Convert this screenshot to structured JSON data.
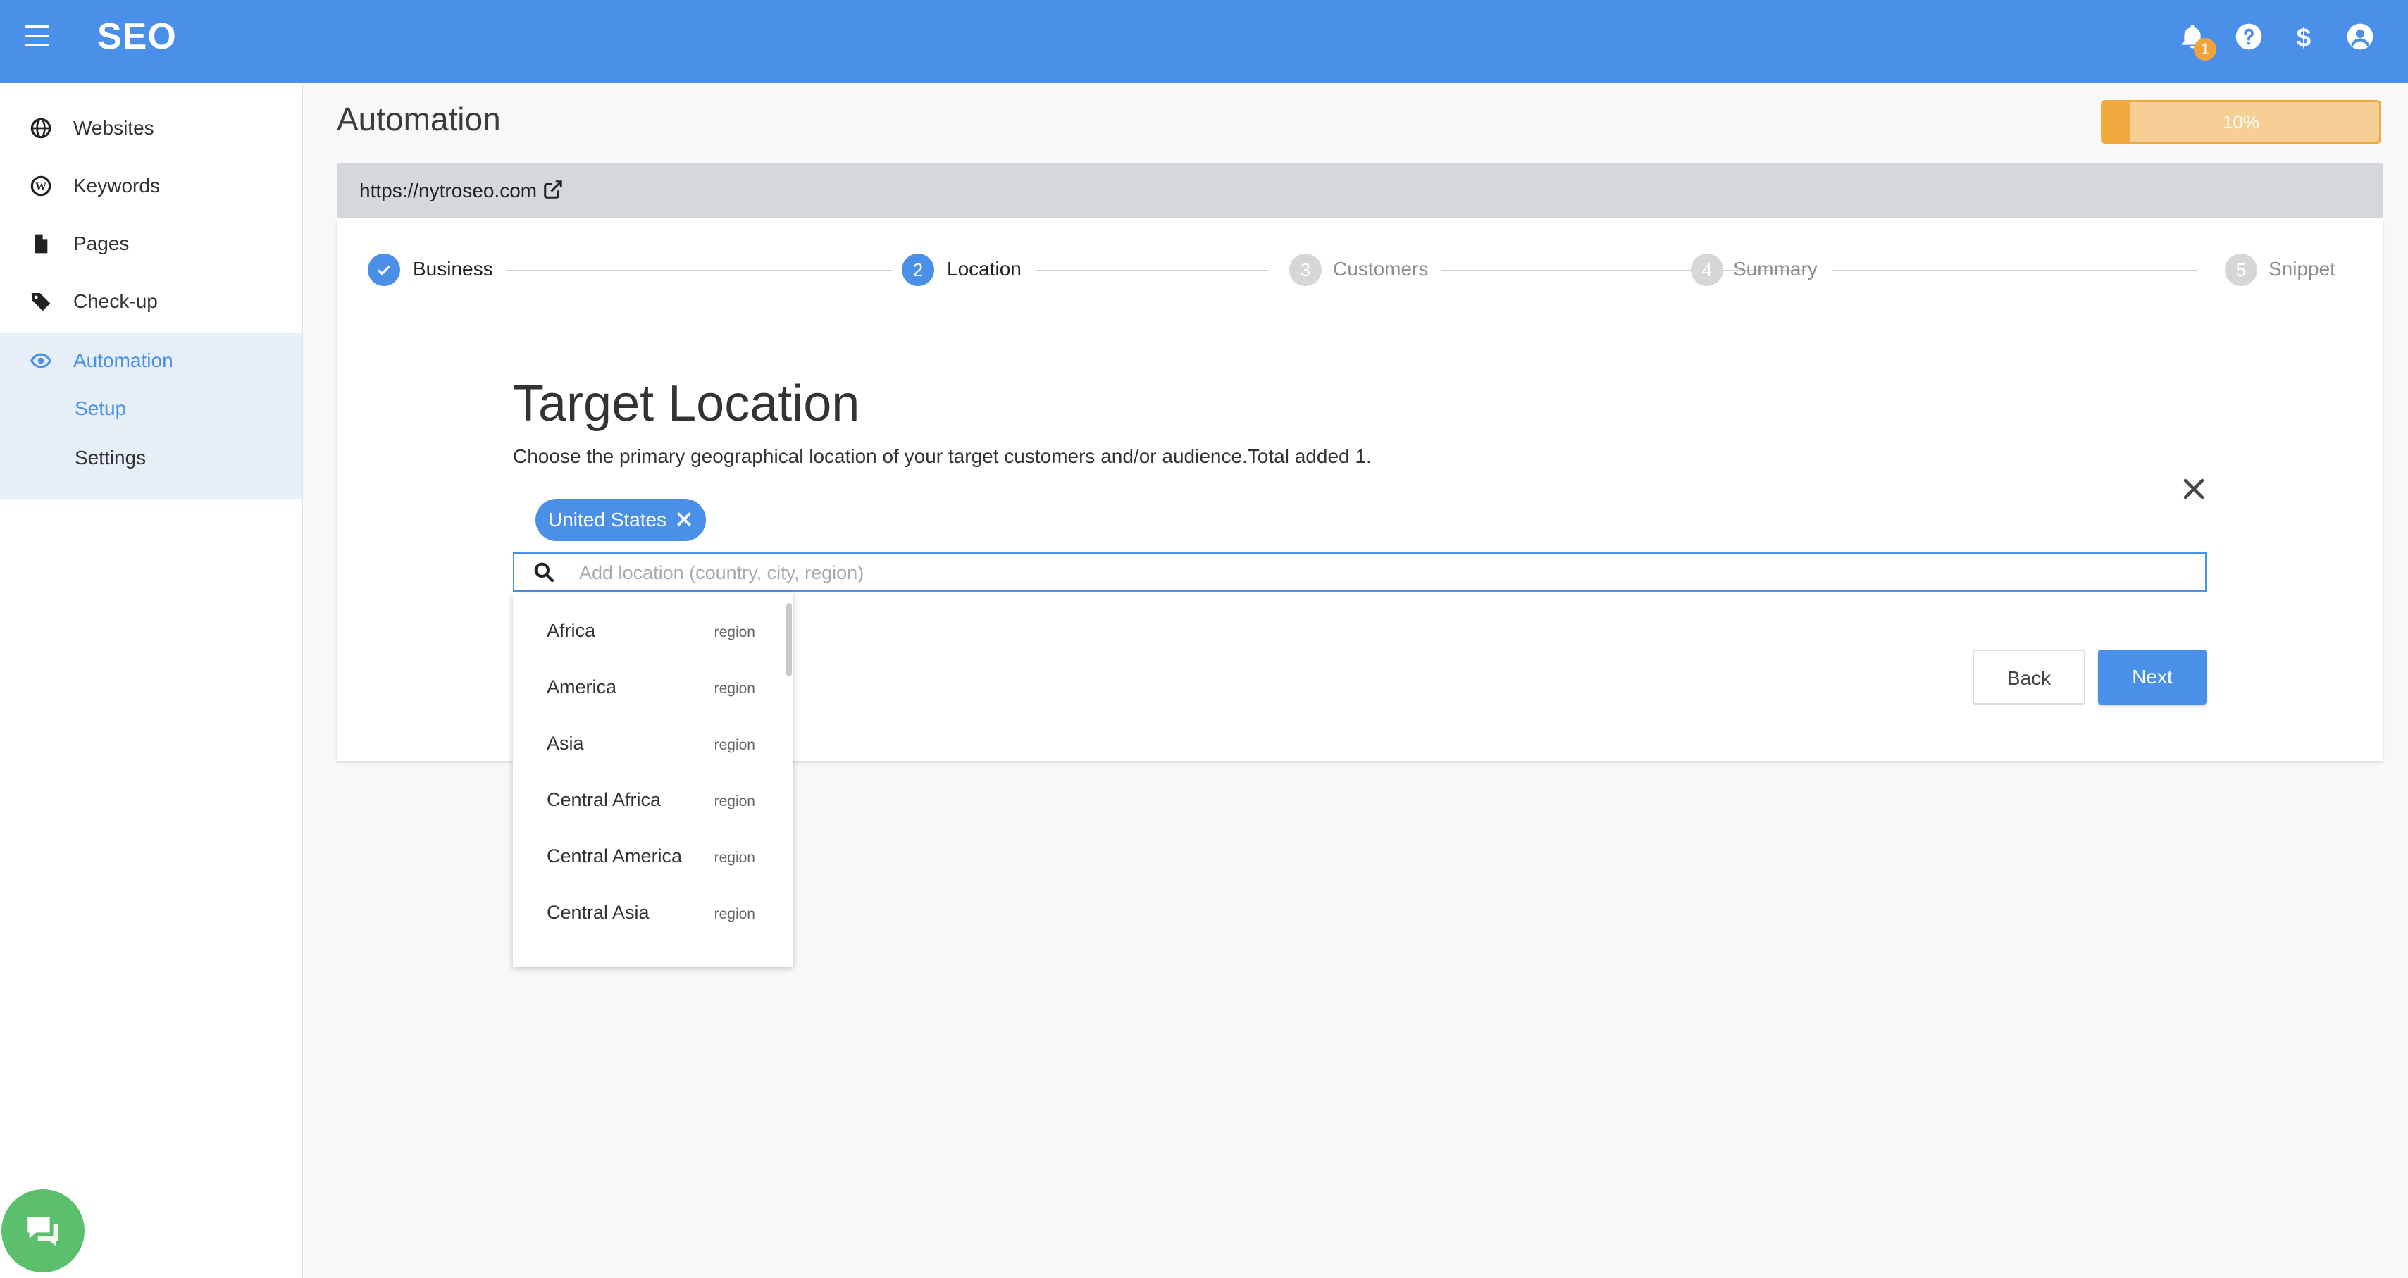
{
  "app": {
    "brand": "SEO",
    "notification_count": "1"
  },
  "sidebar": {
    "items": [
      {
        "label": "Websites",
        "icon": "globe-icon"
      },
      {
        "label": "Keywords",
        "icon": "wordpress-icon"
      },
      {
        "label": "Pages",
        "icon": "file-icon"
      },
      {
        "label": "Check-up",
        "icon": "tag-icon"
      },
      {
        "label": "Automation",
        "icon": "eye-icon",
        "active": true
      }
    ],
    "sub_items": [
      {
        "label": "Setup",
        "active": true
      },
      {
        "label": "Settings"
      }
    ]
  },
  "page": {
    "title": "Automation",
    "progress_label": "10%",
    "progress_value": 0.1
  },
  "url_bar": {
    "url": "https://nytroseo.com"
  },
  "stepper": {
    "steps": [
      {
        "number": "1",
        "label": "Business",
        "state": "done"
      },
      {
        "number": "2",
        "label": "Location",
        "state": "active"
      },
      {
        "number": "3",
        "label": "Customers",
        "state": "pending"
      },
      {
        "number": "4",
        "label": "Summary",
        "state": "pending"
      },
      {
        "number": "5",
        "label": "Snippet",
        "state": "pending"
      }
    ]
  },
  "form": {
    "heading": "Target Location",
    "description": "Choose the primary geographical location of your target customers and/or audience.Total added 1.",
    "chip": "United States",
    "search_placeholder": "Add location (country, city, region)",
    "back_label": "Back",
    "next_label": "Next"
  },
  "dropdown": {
    "options": [
      {
        "name": "Africa",
        "type": "region"
      },
      {
        "name": "America",
        "type": "region"
      },
      {
        "name": "Asia",
        "type": "region"
      },
      {
        "name": "Central Africa",
        "type": "region"
      },
      {
        "name": "Central America",
        "type": "region"
      },
      {
        "name": "Central Asia",
        "type": "region"
      }
    ]
  },
  "colors": {
    "primary": "#4a90e9",
    "accent": "#f0a93e",
    "chat": "#5cbf6b"
  }
}
